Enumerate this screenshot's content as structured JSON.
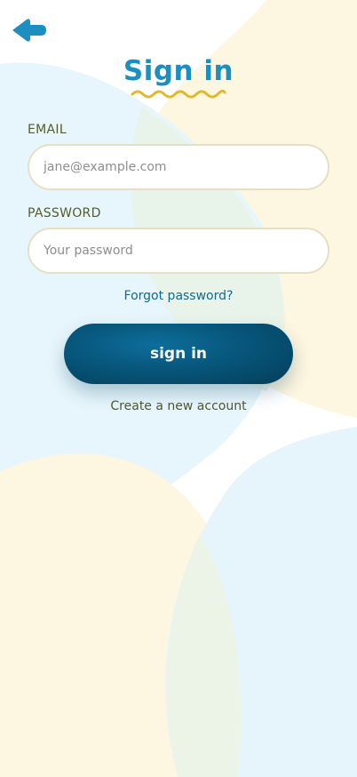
{
  "page": {
    "title": "Sign in",
    "colors": {
      "accent": "#1a8fc0",
      "button": "#07567b",
      "link": "#0f6a93",
      "squiggle": "#e0b92c",
      "label": "#555b2c",
      "input_border": "#e6dfc3",
      "blob_blue": "#e6f5fc",
      "blob_yellow": "#fdf6e0"
    }
  },
  "back": {
    "icon": "arrow-left-icon"
  },
  "form": {
    "email_label": "EMAIL",
    "email_placeholder": "jane@example.com",
    "email_value": "",
    "password_label": "PASSWORD",
    "password_placeholder": "Your password",
    "password_value": ""
  },
  "links": {
    "forgot": "Forgot password?",
    "create": "Create a new account"
  },
  "buttons": {
    "signin": "sign in"
  }
}
